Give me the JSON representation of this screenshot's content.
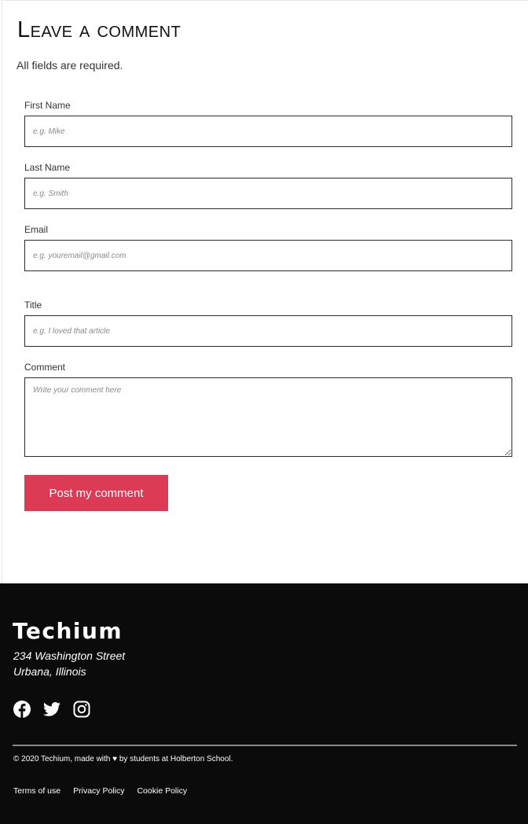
{
  "form": {
    "heading": "Leave a comment",
    "subtitle": "All fields are required.",
    "first_name": {
      "label": "First Name",
      "placeholder": "e.g. Mike"
    },
    "last_name": {
      "label": "Last Name",
      "placeholder": "e.g. Smith"
    },
    "email": {
      "label": "Email",
      "placeholder": "e.g. youremail@gmail.com"
    },
    "title": {
      "label": "Title",
      "placeholder": "e.g. I loved that article"
    },
    "comment": {
      "label": "Comment",
      "placeholder": "Write your comment here"
    },
    "submit_label": "Post my comment",
    "accent_color": "#dc3a55"
  },
  "footer": {
    "brand": "Techium",
    "address_line1": "234 Washington Street",
    "address_line2": "Urbana, Illinois",
    "social_icons": [
      "facebook-icon",
      "twitter-icon",
      "instagram-icon"
    ],
    "copyright": "© 2020 Techium, made with ♥ by students at Holberton School.",
    "links": [
      "Terms of use",
      "Privacy Policy",
      "Cookie Policy"
    ],
    "background_color": "#0b0b0b"
  }
}
